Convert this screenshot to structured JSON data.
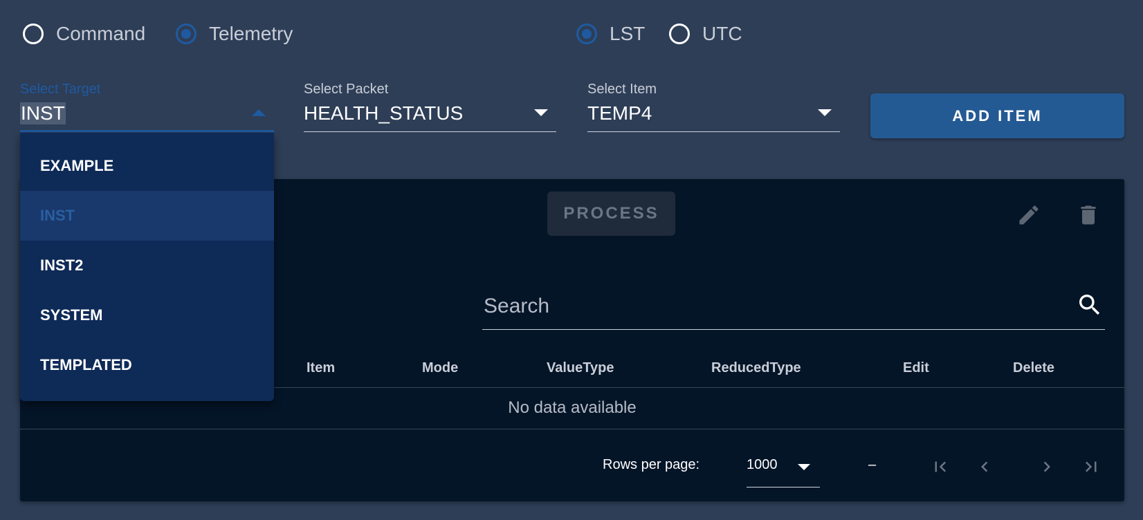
{
  "mode_radios": [
    {
      "label": "Command",
      "checked": false
    },
    {
      "label": "Telemetry",
      "checked": true
    }
  ],
  "time_radios": [
    {
      "label": "LST",
      "checked": true
    },
    {
      "label": "UTC",
      "checked": false
    }
  ],
  "target": {
    "label": "Select Target",
    "value": "INST"
  },
  "packet": {
    "label": "Select Packet",
    "value": "HEALTH_STATUS"
  },
  "item": {
    "label": "Select Item",
    "value": "TEMP4"
  },
  "add_item_label": "ADD ITEM",
  "process_label": "PROCESS",
  "search": {
    "placeholder": "Search"
  },
  "table": {
    "headers": [
      "Item",
      "Mode",
      "ValueType",
      "ReducedType",
      "Edit",
      "Delete"
    ],
    "empty_text": "No data available"
  },
  "footer": {
    "rows_per_page_label": "Rows per page:",
    "rows_per_page_value": "1000",
    "range_text": "–"
  },
  "target_options": [
    {
      "label": "EXAMPLE",
      "active": false
    },
    {
      "label": "INST",
      "active": true
    },
    {
      "label": "INST2",
      "active": false
    },
    {
      "label": "SYSTEM",
      "active": false
    },
    {
      "label": "TEMPLATED",
      "active": false
    }
  ],
  "colors": {
    "accent": "#1f5aa0",
    "background": "#2e3e57",
    "card": "#051528",
    "menu": "#0e2a57"
  }
}
